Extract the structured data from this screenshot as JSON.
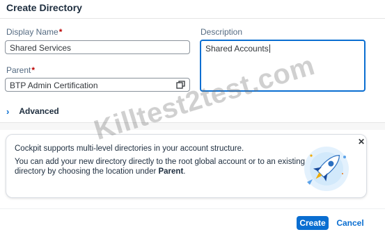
{
  "dialog": {
    "title": "Create Directory"
  },
  "form": {
    "display_name": {
      "label": "Display Name",
      "required_mark": "*",
      "value": "Shared Services"
    },
    "parent": {
      "label": "Parent",
      "required_mark": "*",
      "value": "BTP Admin Certification",
      "icon": "value-help-icon"
    },
    "description": {
      "label": "Description",
      "value": "Shared Accounts"
    },
    "advanced": {
      "label": "Advanced",
      "icon": "chevron-right-icon"
    }
  },
  "info": {
    "line1": "Cockpit supports multi-level directories in your account structure.",
    "line2": "You can add your new directory directly to the root global account or to an existing",
    "line3_prefix": "directory by choosing the location under ",
    "line3_bold": "Parent",
    "line3_suffix": ".",
    "close_icon": "close-icon",
    "illustration": "rocket-illustration"
  },
  "footer": {
    "create_label": "Create",
    "cancel_label": "Cancel"
  },
  "watermark": "Killtest2test.com",
  "colors": {
    "accent": "#0a6ed1",
    "required": "#bb0000",
    "label": "#556b82"
  }
}
